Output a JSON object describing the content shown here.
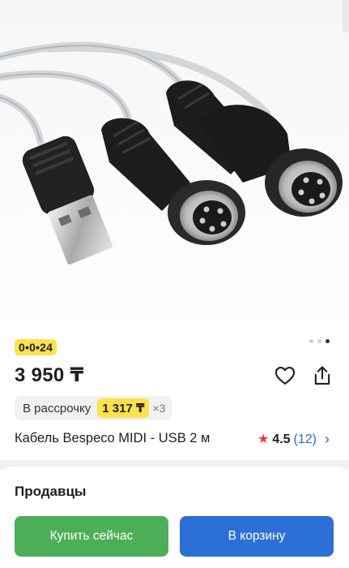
{
  "product": {
    "badge": "0•0•24",
    "price": "3 950 ₸",
    "title": "Кабель Bespeco MIDI - USB 2 м",
    "rating_value": "4.5",
    "rating_count": "(12)"
  },
  "installment": {
    "label": "В рассрочку",
    "amount": "1 317 ₸",
    "multiplier": "×3"
  },
  "sellers": {
    "heading": "Продавцы"
  },
  "actions": {
    "buy_now": "Купить сейчас",
    "add_to_cart": "В корзину"
  },
  "gallery": {
    "slide_count": 3,
    "active_index": 2
  },
  "colors": {
    "badge_yellow": "#ffe14b",
    "buy_green": "#4caf58",
    "cart_blue": "#2c6fd6",
    "rating_star": "#e53935",
    "link_blue": "#2a68d8"
  },
  "icons": {
    "favorite": "heart-outline-icon",
    "share": "share-icon",
    "rating": "star-icon",
    "chevron": "chevron-right-icon"
  }
}
